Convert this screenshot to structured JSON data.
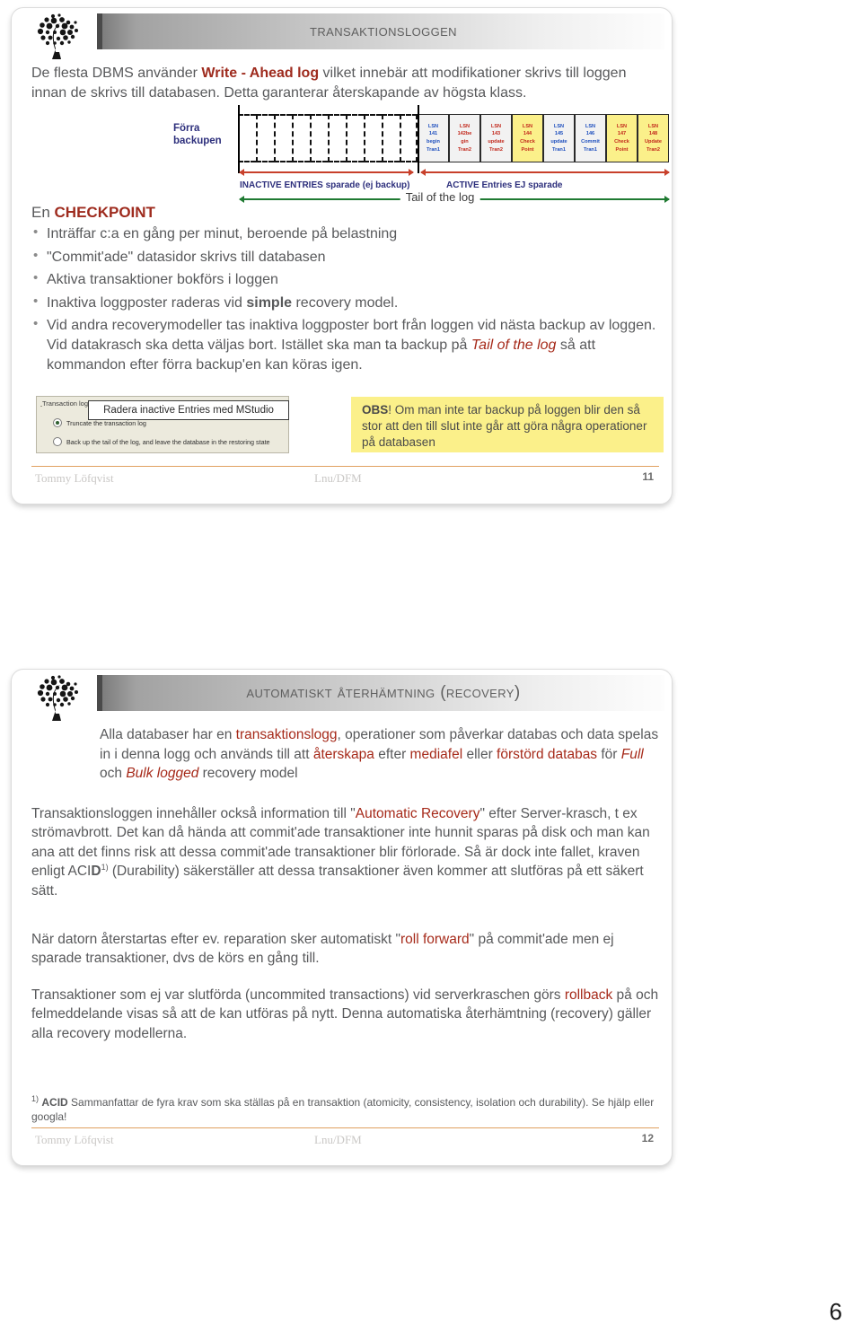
{
  "document": {
    "page_number": "6"
  },
  "slide11": {
    "title": "Transaktionsloggen",
    "logo_name": "tree-logo",
    "intro": {
      "part1": "De flesta DBMS använder ",
      "bold": "Write - Ahead log",
      "part2": " vilket innebär att modifikationer skrivs till loggen innan de skrivs till databasen. Detta garanterar återskapande av högsta klass."
    },
    "diagram": {
      "prev_backup_label": "Förra backupen",
      "inactive_cell_count": 10,
      "entries": [
        {
          "lsn": "LSN",
          "num": "141",
          "op": "begin",
          "tran": "Tran1",
          "color": "blue",
          "highlight": false
        },
        {
          "lsn": "LSN",
          "num": "142be",
          "op": "gin",
          "tran": "Tran2",
          "color": "red",
          "highlight": false
        },
        {
          "lsn": "LSN",
          "num": "143",
          "op": "update",
          "tran": "Tran2",
          "color": "red",
          "highlight": false
        },
        {
          "lsn": "LSN",
          "num": "144",
          "op": "Check",
          "tran": "Point",
          "color": "red",
          "highlight": true
        },
        {
          "lsn": "LSN",
          "num": "145",
          "op": "update",
          "tran": "Tran1",
          "color": "blue",
          "highlight": false
        },
        {
          "lsn": "LSN",
          "num": "146",
          "op": "Commit",
          "tran": "Tran1",
          "color": "blue",
          "highlight": false
        },
        {
          "lsn": "LSN",
          "num": "147",
          "op": "Check",
          "tran": "Point",
          "color": "red",
          "highlight": true
        },
        {
          "lsn": "LSN",
          "num": "148",
          "op": "Update",
          "tran": "Tran2",
          "color": "red",
          "highlight": true
        }
      ],
      "inactive_label": "INACTIVE ENTRIES sparade (ej backup)",
      "active_label": "ACTIVE Entries EJ sparade",
      "tail_label": "Tail of the log",
      "colors": {
        "label_blue": "#2d2f7c",
        "arrow_red": "#c8402b",
        "arrow_green": "#1f7a32",
        "highlight_yellow": "#fbf08a"
      }
    },
    "checkpoint": {
      "head_prefix": "En ",
      "head_word": "CHECKPOINT",
      "bullets": [
        {
          "text": "Inträffar c:a en gång per minut, beroende på belastning"
        },
        {
          "text": "\"Commit'ade\" datasidor skrivs till databasen"
        },
        {
          "text": "Aktiva transaktioner bokförs i loggen"
        },
        {
          "pre": "Inaktiva loggposter raderas vid ",
          "bold": "simple",
          "post": " recovery model."
        },
        {
          "pre": "Vid andra recoverymodeller tas inaktiva loggposter bort från loggen vid nästa backup av loggen. Vid datakrasch ska detta väljas bort. Istället ska man ta backup på ",
          "italic": "Tail of the log",
          "post": " så att kommandon efter förra backup'en kan köras igen."
        }
      ]
    },
    "mstudio": {
      "fieldset_label": "Transaction log",
      "option1": "Truncate the transaction log",
      "option2": "Back up the tail of the log, and leave the database in the restoring state",
      "selected": "option1",
      "callout": "Radera inactive Entries med MStudio"
    },
    "obs": {
      "bold": "OBS",
      "text": "! Om man inte tar backup på loggen blir den så stor att den till slut inte går att göra några operationer på databasen"
    },
    "footer": {
      "author": "Tommy Löfqvist",
      "org": "Lnu/DFM",
      "page": "11"
    }
  },
  "slide12": {
    "title": "Automatiskt Återhämtning (Recovery)",
    "logo_name": "tree-logo",
    "lead": {
      "a": "Alla databaser har en ",
      "r1": "transaktionslogg",
      "b": ", operationer som påverkar databas och data spelas in i denna logg och används till att ",
      "r2": "återskapa",
      "c": " efter ",
      "r3": "mediafel",
      "d": " eller ",
      "r4": "förstörd databas",
      "e": " för ",
      "i1": "Full",
      "f": " och ",
      "i2": "Bulk logged",
      "g": " recovery model"
    },
    "paragraph1": {
      "a": "Transaktionsloggen innehåller också information till \"",
      "r1": "Automatic Recovery",
      "b": "\" efter Server-krasch, t ex strömavbrott. Det kan då hända att commit'ade transaktioner inte hunnit sparas på disk och man kan ana att det finns risk att dessa commit'ade transaktioner blir förlorade. Så är dock inte fallet, kraven enligt ACI",
      "bold1": "D",
      "sup": "1)",
      "c": " (Durability) säkerställer att dessa transaktioner även kommer att slutföras på ett säkert sätt."
    },
    "paragraph2": {
      "a": "När datorn återstartas efter ev. reparation sker automatiskt \"",
      "r1": "roll forward",
      "b": "\" på commit'ade men ej sparade transaktioner, dvs de körs en gång till."
    },
    "paragraph3": {
      "a": "Transaktioner som ej var slutförda (uncommited transactions) vid serverkraschen görs ",
      "r1": "rollback",
      "b": " på och felmeddelande visas så att de kan utföras på nytt. Denna automatiska återhämtning (recovery) gäller alla recovery modellerna."
    },
    "note": {
      "sup": "1)",
      "bold": "ACID",
      "text": " Sammanfattar de fyra krav som ska ställas på en transaktion (atomicity, consistency, isolation och durability). Se hjälp eller googla!"
    },
    "footer": {
      "author": "Tommy Löfqvist",
      "org": "Lnu/DFM",
      "page": "12"
    }
  }
}
